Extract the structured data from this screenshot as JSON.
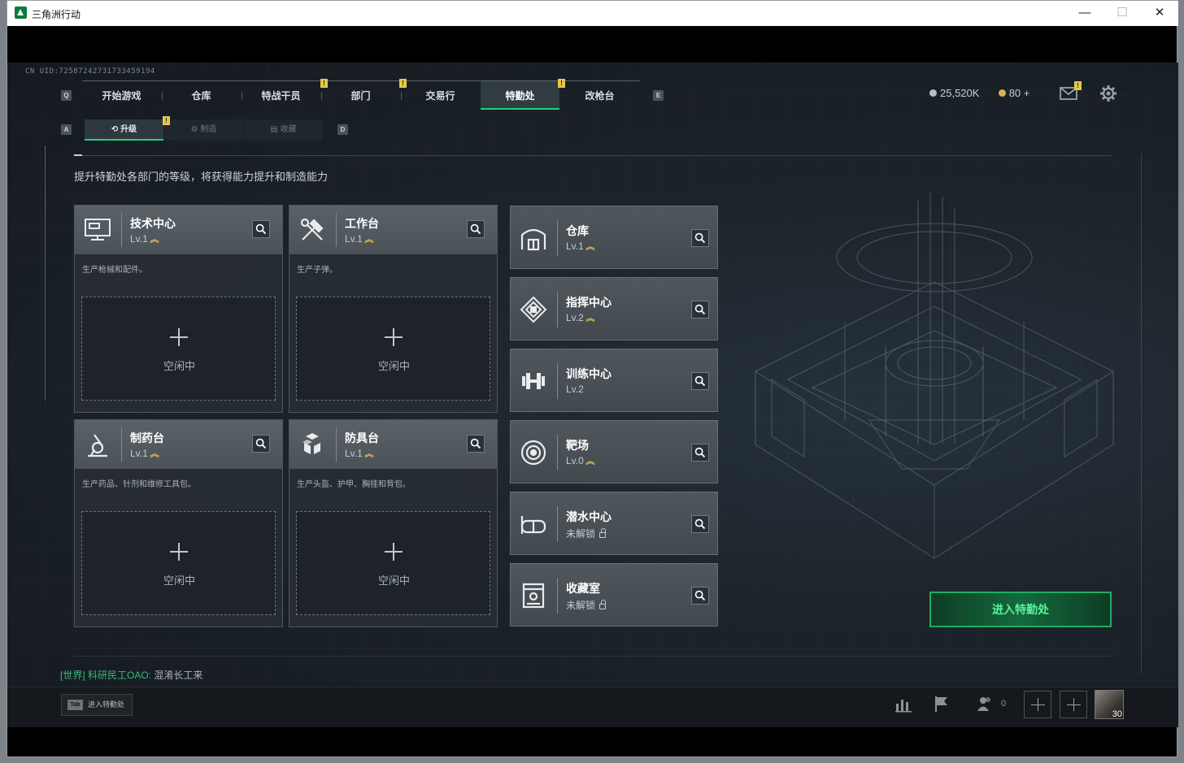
{
  "window": {
    "title": "三角洲行动",
    "controls": {
      "minimize": "—",
      "maximize": "☐",
      "close": "✕"
    }
  },
  "uid": "CN UID:72587242731733459194",
  "keys": {
    "prev": "Q",
    "next": "E",
    "sub_prev": "A",
    "sub_next": "D"
  },
  "nav": {
    "tabs": [
      {
        "label": "开始游戏"
      },
      {
        "label": "仓库"
      },
      {
        "label": "特战干员"
      },
      {
        "label": "部门"
      },
      {
        "label": "交易行"
      },
      {
        "label": "特勤处",
        "active": true
      },
      {
        "label": "改枪台"
      }
    ],
    "notif_mark": "!"
  },
  "subnav": {
    "tabs": [
      {
        "label": "升级",
        "active": true
      },
      {
        "label": "制造"
      },
      {
        "label": "收藏"
      }
    ]
  },
  "currency": {
    "coins": "25,520K",
    "bonds": "80 +",
    "coin_color": "#b9bfc5",
    "bond_color": "#d9b24c"
  },
  "description": "提升特勤处各部门的等级，将获得能力提升和制造能力",
  "production_cards": [
    {
      "name": "技术中心",
      "level": "Lv.1",
      "upgradable": true,
      "desc": "生产枪械和配件。",
      "slot": "空闲中",
      "icon": "computer-icon"
    },
    {
      "name": "工作台",
      "level": "Lv.1",
      "upgradable": true,
      "desc": "生产子弹。",
      "slot": "空闲中",
      "icon": "hammer-wrench-icon"
    },
    {
      "name": "制药台",
      "level": "Lv.1",
      "upgradable": true,
      "desc": "生产药品、针剂和维修工具包。",
      "slot": "空闲中",
      "icon": "microscope-icon"
    },
    {
      "name": "防具台",
      "level": "Lv.1",
      "upgradable": true,
      "desc": "生产头盔、护甲、胸挂和背包。",
      "slot": "空闲中",
      "icon": "cubes-icon"
    }
  ],
  "facility_rows": [
    {
      "name": "仓库",
      "level": "Lv.1",
      "upgradable": true,
      "icon": "warehouse-icon"
    },
    {
      "name": "指挥中心",
      "level": "Lv.2",
      "upgradable": true,
      "icon": "command-chip-icon"
    },
    {
      "name": "训练中心",
      "level": "Lv.2",
      "upgradable": false,
      "icon": "dumbbell-icon"
    },
    {
      "name": "靶场",
      "level": "Lv.0",
      "upgradable": true,
      "icon": "target-icon"
    },
    {
      "name": "潜水中心",
      "level": "未解锁",
      "locked": true,
      "icon": "diving-mask-icon"
    },
    {
      "name": "收藏室",
      "level": "未解锁",
      "locked": true,
      "icon": "display-case-icon"
    }
  ],
  "enter_button": "进入特勤处",
  "chat": {
    "channel": "[世界]",
    "user": "科研民工OAO:",
    "message": "混淆长工来"
  },
  "tab_hint": {
    "key": "Tab",
    "label": "进入特勤处"
  },
  "friends_online": "0",
  "player_level": "30",
  "accent_color": "#21d07d",
  "upgrade_arrow": "︽"
}
